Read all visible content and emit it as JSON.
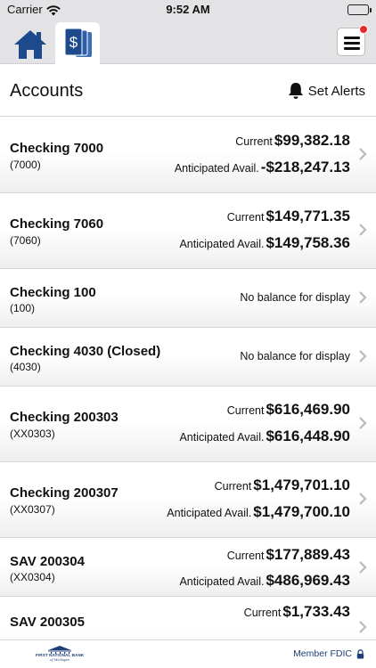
{
  "status_bar": {
    "carrier": "Carrier",
    "time": "9:52 AM"
  },
  "nav": {
    "home_icon": "home-icon",
    "accounts_icon": "dollar-cards-icon",
    "menu_icon": "hamburger-menu-icon",
    "accent_color": "#1d4a8c",
    "notification_color": "#e32a2a"
  },
  "header": {
    "title": "Accounts",
    "alerts_label": "Set Alerts"
  },
  "accounts": [
    {
      "name": "Checking 7000",
      "number": "(7000)",
      "current_label": "Current",
      "current": "$99,382.18",
      "anticipated_label": "Anticipated Avail.",
      "anticipated": "-$218,247.13"
    },
    {
      "name": "Checking 7060",
      "number": "(7060)",
      "current_label": "Current",
      "current": "$149,771.35",
      "anticipated_label": "Anticipated Avail.",
      "anticipated": "$149,758.36"
    },
    {
      "name": "Checking 100",
      "number": "(100)",
      "no_balance": "No balance for display"
    },
    {
      "name": "Checking 4030 (Closed)",
      "number": "(4030)",
      "no_balance": "No balance for display"
    },
    {
      "name": "Checking 200303",
      "number": "(XX0303)",
      "current_label": "Current",
      "current": "$616,469.90",
      "anticipated_label": "Anticipated Avail.",
      "anticipated": "$616,448.90"
    },
    {
      "name": "Checking 200307",
      "number": "(XX0307)",
      "current_label": "Current",
      "current": "$1,479,701.10",
      "anticipated_label": "Anticipated Avail.",
      "anticipated": "$1,479,700.10"
    },
    {
      "name": "SAV 200304",
      "number": "(XX0304)",
      "current_label": "Current",
      "current": "$177,889.43",
      "anticipated_label": "Anticipated Avail.",
      "anticipated": "$486,969.43"
    },
    {
      "name": "SAV 200305",
      "current_label": "Current",
      "current": "$1,733.43"
    }
  ],
  "footer": {
    "bank_name": "FIRST NATIONAL BANK",
    "bank_sub": "of Michigan",
    "member_text": "Member FDIC",
    "lock_icon": "lock-icon",
    "brand_color": "#1f3f7a"
  }
}
